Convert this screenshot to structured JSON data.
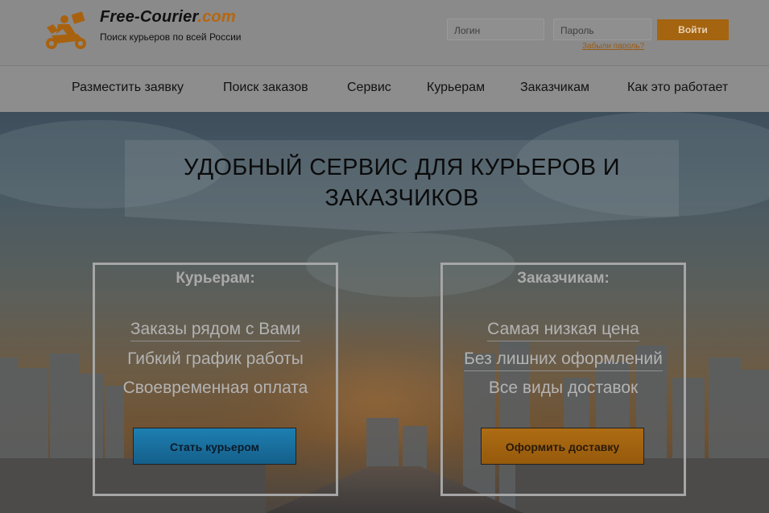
{
  "header": {
    "logo_name": "Free-Courier",
    "logo_domain": ".com",
    "logo_tagline": "Поиск курьеров по всей России",
    "login_placeholder": "Логин",
    "password_placeholder": "Пароль",
    "login_button": "Войти",
    "forgot_link": "Забыли пароль?",
    "logo_icon": "courier-scooter-icon",
    "accent_color": "#a5640f"
  },
  "nav": {
    "items": [
      {
        "label": "Разместить заявку"
      },
      {
        "label": "Поиск заказов"
      },
      {
        "label": "Сервис"
      },
      {
        "label": "Курьерам"
      },
      {
        "label": "Заказчикам"
      },
      {
        "label": "Как это работает"
      }
    ]
  },
  "hero": {
    "title_line1": "УДОБНЫЙ СЕРВИС ДЛЯ КУРЬЕРОВ И",
    "title_line2": "ЗАКАЗЧИКОВ",
    "couriers": {
      "heading": "Курьерам:",
      "points": [
        "Заказы рядом с Вами",
        "Гибкий график работы",
        "Своевременная оплата"
      ],
      "button": "Стать курьером"
    },
    "customers": {
      "heading": "Заказчикам:",
      "points": [
        "Самая низкая цена",
        "Без лишних оформлений",
        "Все виды доставок"
      ],
      "button": "Оформить доставку"
    }
  }
}
